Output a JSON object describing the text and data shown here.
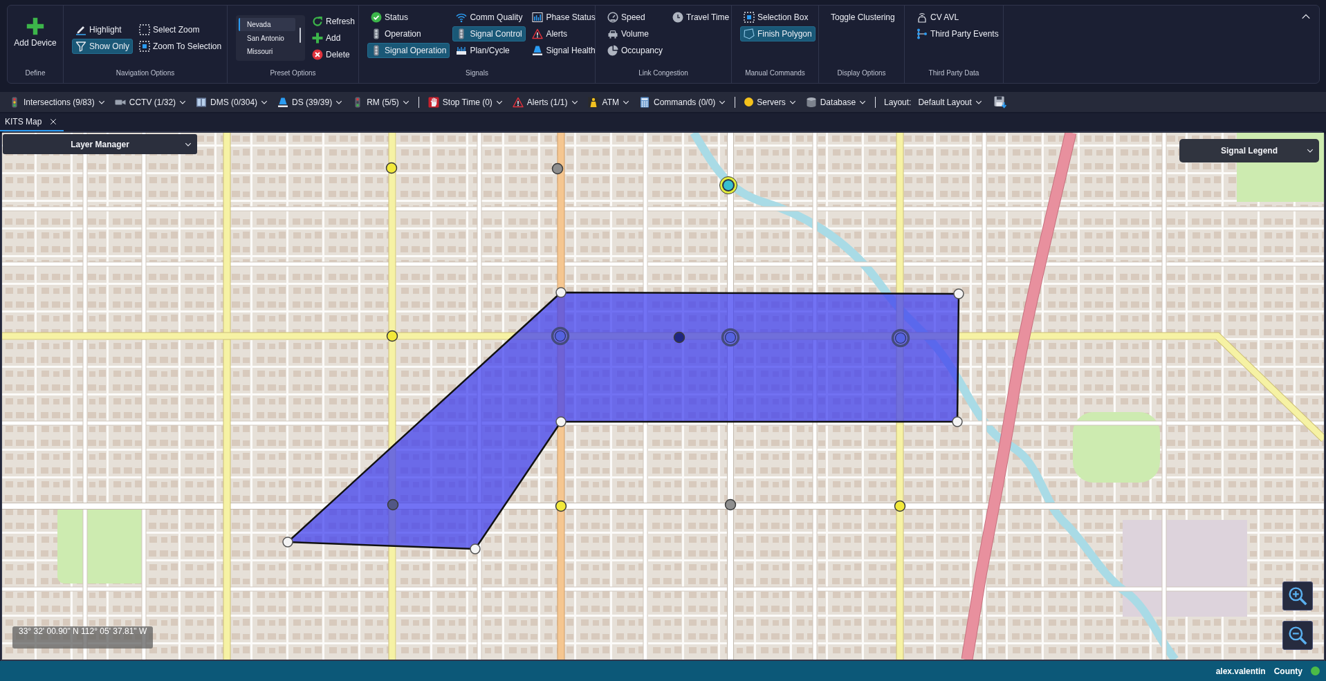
{
  "ribbon": {
    "groups": [
      {
        "label": "Define",
        "kind": "large",
        "columns": [
          [
            {
              "label": "Add Device",
              "selected": false
            }
          ]
        ]
      },
      {
        "label": "Navigation Options",
        "kind": "buttons",
        "columns": [
          [
            {
              "label": "Highlight",
              "selected": false
            },
            {
              "label": "Show Only",
              "selected": true
            }
          ],
          [
            {
              "label": "Select Zoom",
              "selected": false
            },
            {
              "label": "Zoom To Selection",
              "selected": false
            }
          ]
        ]
      },
      {
        "label": "Preset Options",
        "kind": "presets",
        "presets": [
          {
            "label": "Nevada",
            "selected": true
          },
          {
            "label": "San Antonio",
            "selected": false
          },
          {
            "label": "Missouri",
            "selected": false
          }
        ],
        "columns": [
          [
            {
              "label": "Refresh",
              "selected": false
            },
            {
              "label": "Add",
              "selected": false
            },
            {
              "label": "Delete",
              "selected": false
            }
          ]
        ]
      },
      {
        "label": "Signals",
        "kind": "buttons",
        "columns": [
          [
            {
              "label": "Status",
              "selected": false
            },
            {
              "label": "Operation",
              "selected": false
            },
            {
              "label": "Signal Operation",
              "selected": true
            }
          ],
          [
            {
              "label": "Comm Quality",
              "selected": false
            },
            {
              "label": "Signal Control",
              "selected": true
            },
            {
              "label": "Plan/Cycle",
              "selected": false
            }
          ],
          [
            {
              "label": "Phase Status",
              "selected": false
            },
            {
              "label": "Alerts",
              "selected": false
            },
            {
              "label": "Signal Health",
              "selected": false
            }
          ]
        ]
      },
      {
        "label": "Link Congestion",
        "kind": "buttons",
        "columns": [
          [
            {
              "label": "Speed",
              "selected": false
            },
            {
              "label": "Volume",
              "selected": false
            },
            {
              "label": "Occupancy",
              "selected": false
            }
          ],
          [
            {
              "label": "Travel Time",
              "selected": false
            }
          ]
        ]
      },
      {
        "label": "Manual Commands",
        "kind": "buttons",
        "columns": [
          [
            {
              "label": "Selection Box",
              "selected": false
            },
            {
              "label": "Finish Polygon",
              "selected": true
            }
          ]
        ]
      },
      {
        "label": "Display Options",
        "kind": "buttons",
        "columns": [
          [
            {
              "label": "Toggle Clustering",
              "selected": false
            }
          ]
        ]
      },
      {
        "label": "Third Party Data",
        "kind": "buttons",
        "columns": [
          [
            {
              "label": "CV AVL",
              "selected": false
            },
            {
              "label": "Third Party Events",
              "selected": false
            }
          ]
        ]
      }
    ]
  },
  "toolbar": {
    "items": [
      {
        "kind": "dropdown",
        "label": "Intersections (9/83)"
      },
      {
        "kind": "dropdown",
        "label": "CCTV (1/32)"
      },
      {
        "kind": "dropdown",
        "label": "DMS (0/304)"
      },
      {
        "kind": "dropdown",
        "label": "DS (39/39)"
      },
      {
        "kind": "dropdown",
        "label": "RM (5/5)"
      },
      {
        "kind": "separator"
      },
      {
        "kind": "dropdown",
        "label": "Stop Time (0)"
      },
      {
        "kind": "dropdown",
        "label": "Alerts (1/1)"
      },
      {
        "kind": "dropdown",
        "label": "ATM"
      },
      {
        "kind": "dropdown",
        "label": "Commands (0/0)"
      },
      {
        "kind": "separator"
      },
      {
        "kind": "status",
        "label": "Servers",
        "color": "#f5c21b"
      },
      {
        "kind": "dropdown",
        "label": "Database"
      },
      {
        "kind": "separator"
      },
      {
        "kind": "label",
        "label": "Layout:"
      },
      {
        "kind": "dropdown",
        "label": "Default Layout"
      },
      {
        "kind": "action"
      }
    ]
  },
  "tabs": [
    {
      "label": "KITS Map",
      "selected": true
    }
  ],
  "map": {
    "layer_manager": {
      "label": "Layer Manager"
    },
    "signal_legend": {
      "label": "Signal Legend"
    },
    "coordinates": "33° 32' 00.90\" N 112° 05' 37.81\" W",
    "signals": [
      {
        "kind": "dot",
        "color": "#f2e93a"
      },
      {
        "kind": "dot",
        "color": "#8e8e8e"
      },
      {
        "kind": "flagged",
        "color": "#38bfcf"
      },
      {
        "kind": "dot",
        "color": "#f2e93a"
      },
      {
        "kind": "ringed",
        "color": "#5563e0"
      },
      {
        "kind": "dot",
        "color": "#1f2680"
      },
      {
        "kind": "ringed",
        "color": "#5563e0"
      },
      {
        "kind": "ringed",
        "color": "#5563e0"
      },
      {
        "kind": "dot",
        "color": "#525785"
      },
      {
        "kind": "dot",
        "color": "#f2e93a"
      },
      {
        "kind": "dot",
        "color": "#8e8e8e"
      },
      {
        "kind": "dot",
        "color": "#f2e93a"
      }
    ]
  },
  "status_bar": {
    "items": [
      {
        "label": "alex.valentin"
      },
      {
        "label": "County"
      }
    ],
    "indicator": {
      "color": "#4cbb47"
    }
  }
}
